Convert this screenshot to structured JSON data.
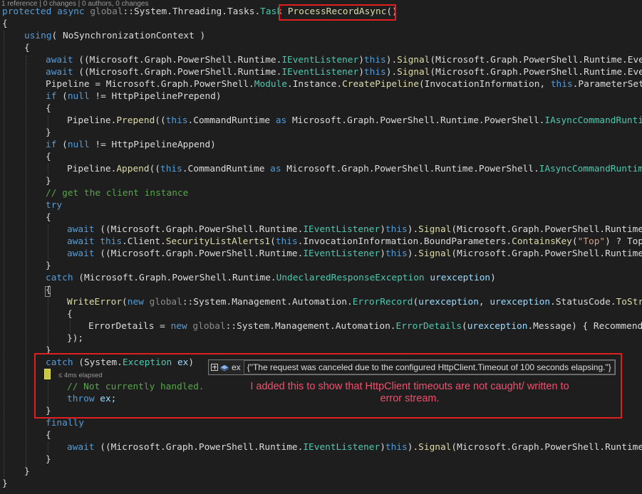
{
  "codelens": "1 reference | 0 changes | 0 authors, 0 changes",
  "code": {
    "l1_protected": "protected",
    "l1_async": "async",
    "l1_global": "global",
    "l1_sep": "::",
    "l1_ns": "System.Threading.Tasks.",
    "l1_task": "Task",
    "l1_method": "ProcessRecordAsync",
    "l1_parens": "()",
    "open_brace": "{",
    "close_brace": "}",
    "using_kw": "using",
    "using_rest": "( NoSynchronizationContext )",
    "await": "await",
    "this": "this",
    "new": "new",
    "null": "null",
    "as": "as",
    "if": "if",
    "try": "try",
    "catch": "catch",
    "finally": "finally",
    "throw": "throw",
    "mgpr": "Microsoft.Graph.PowerShell.Runtime.",
    "ieventlistener": "IEventListener",
    "signal": "Signal",
    "event_tail": "Microsoft.Graph.PowerShell.Runtime.Even",
    "pipeline_assign": "Pipeline = Microsoft.Graph.PowerShell.",
    "module": "Module",
    "instance": ".Instance.",
    "createpipeline": "CreatePipeline",
    "createpipeline_args": "(InvocationInformation, ",
    "parametersetn": ".ParameterSetN",
    "prepend_cond": " != HttpPipelinePrepend)",
    "append_cond": " != HttpPipelineAppend)",
    "pipeline_dot": "Pipeline.",
    "prepend": "Prepend",
    "append": "Append",
    "cmdruntime": ".CommandRuntime ",
    "mgprps": "Microsoft.Graph.PowerShell.Runtime.PowerShell.",
    "iasync_prepend": "IAsyncCommandRuntim",
    "iasync_append": "IAsyncCommandRuntime",
    "comment_client": "// get the client instance",
    "signal_tail": "Microsoft.Graph.PowerShell.Runtime.",
    "client_dot": ".Client.",
    "securitylistalerts": "SecurityListAlerts1",
    "client_args": ".InvocationInformation.BoundParameters.",
    "containskey": "ContainsKey",
    "top_str": "\"Top\"",
    "top_tail": ") ? Top",
    "mgpr_ns": "Microsoft.Graph.PowerShell.Runtime.",
    "undeclared": "UndeclaredResponseException",
    "urexception": "urexception",
    "writeerror": "WriteError",
    "sma": "System.Management.Automation.",
    "errorrecord": "ErrorRecord",
    "statuscode": "StatusCode",
    "tostri": "ToStri",
    "errordetails_assign": "ErrorDetails = ",
    "errordetails": "ErrorDetails",
    "message": ".Message) { Recommende",
    "close_paren_semi": "});",
    "system_dot": "System.",
    "exception": "Exception",
    "ex": "ex",
    "comment_not_handled": "// Not currently handled.",
    "throw_ex": "ex;"
  },
  "debugger": {
    "elapsed": "≤ 4ms elapsed",
    "datatip_name": "ex",
    "datatip_value": "{\"The request was canceled due to the configured HttpClient.Timeout of 100 seconds elapsing.\"}"
  },
  "annotation": {
    "line1": "I added this to show that HttpClient timeouts are not caught/ written to",
    "line2": "error stream."
  },
  "colors": {
    "highlight_box": "#e02020",
    "annotation_text": "#f0506e",
    "keyword": "#569cd6",
    "type": "#4ec9b0",
    "method": "#dcdcaa",
    "comment": "#57a64a",
    "string": "#d69d85"
  }
}
